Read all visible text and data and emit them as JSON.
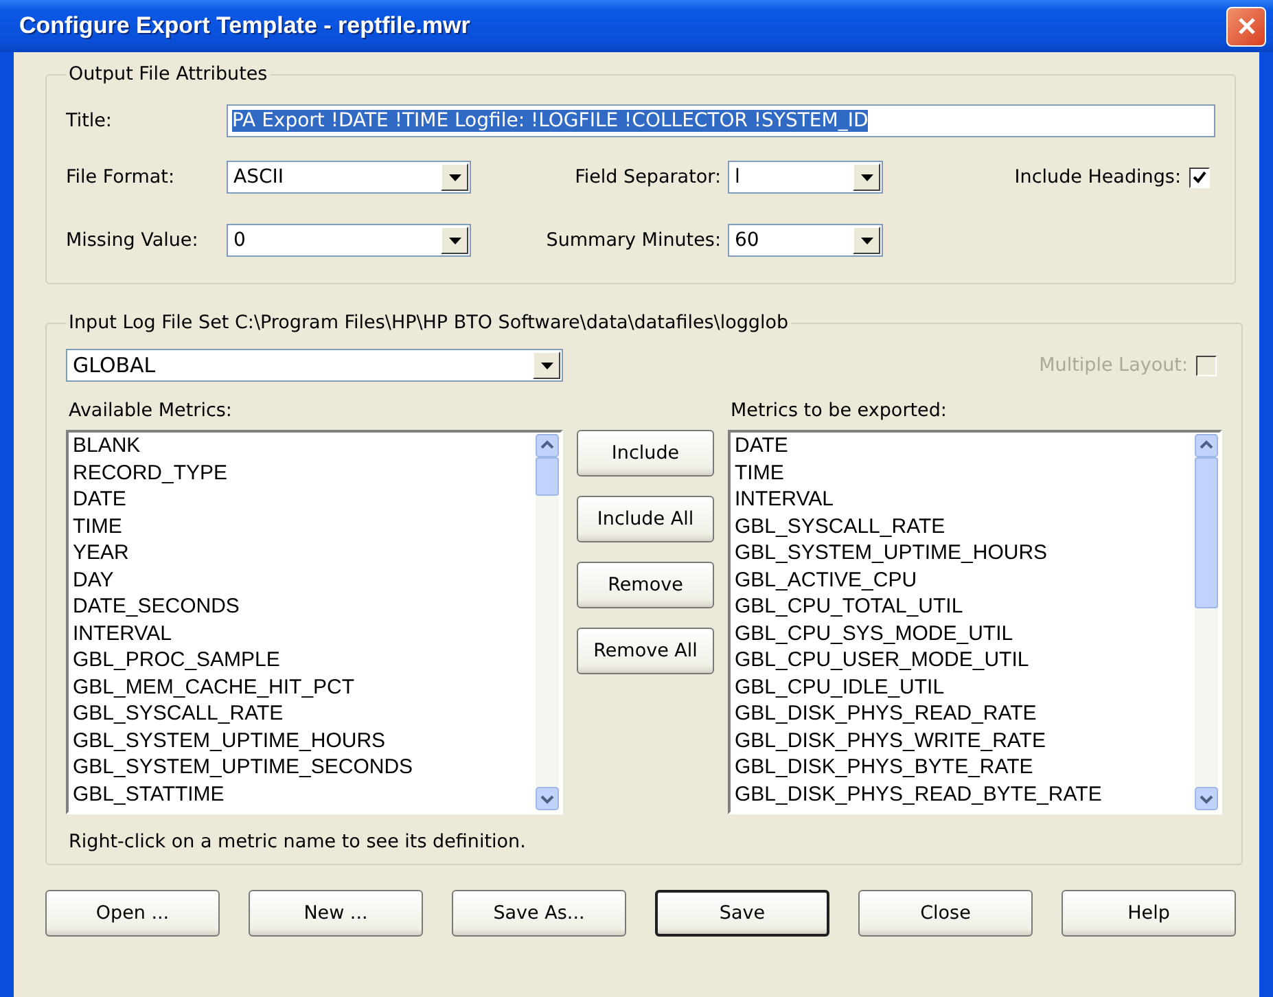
{
  "window": {
    "title": "Configure Export Template - reptfile.mwr"
  },
  "output_group": {
    "legend": "Output File Attributes",
    "title_field": {
      "label": "Title:",
      "value": "PA Export !DATE !TIME Logfile: !LOGFILE !COLLECTOR !SYSTEM_ID",
      "selected": true
    },
    "file_format": {
      "label": "File Format:",
      "value": "ASCII"
    },
    "field_separator": {
      "label": "Field Separator:",
      "value": "l"
    },
    "include_headings": {
      "label": "Include Headings:",
      "checked": true,
      "disabled": false
    },
    "missing_value": {
      "label": "Missing Value:",
      "value": "0"
    },
    "summary_minutes": {
      "label": "Summary Minutes:",
      "value": "60"
    }
  },
  "input_group": {
    "legend": "Input Log File Set C:\\Program Files\\HP\\HP BTO Software\\data\\datafiles\\logglob",
    "class_combo": {
      "value": "GLOBAL"
    },
    "multiple_layout": {
      "label": "Multiple Layout:",
      "checked": false,
      "disabled": true
    },
    "available": {
      "label": "Available Metrics:",
      "items": [
        "BLANK",
        "RECORD_TYPE",
        "DATE",
        "TIME",
        "YEAR",
        "DAY",
        "DATE_SECONDS",
        "INTERVAL",
        "GBL_PROC_SAMPLE",
        "GBL_MEM_CACHE_HIT_PCT",
        "GBL_SYSCALL_RATE",
        "GBL_SYSTEM_UPTIME_HOURS",
        "GBL_SYSTEM_UPTIME_SECONDS",
        "GBL_STATTIME"
      ]
    },
    "move_buttons": [
      "Include",
      "Include All",
      "Remove",
      "Remove All"
    ],
    "exported": {
      "label": "Metrics to be exported:",
      "items": [
        "DATE",
        "TIME",
        "INTERVAL",
        "GBL_SYSCALL_RATE",
        "GBL_SYSTEM_UPTIME_HOURS",
        "GBL_ACTIVE_CPU",
        "GBL_CPU_TOTAL_UTIL",
        "GBL_CPU_SYS_MODE_UTIL",
        "GBL_CPU_USER_MODE_UTIL",
        "GBL_CPU_IDLE_UTIL",
        "GBL_DISK_PHYS_READ_RATE",
        "GBL_DISK_PHYS_WRITE_RATE",
        "GBL_DISK_PHYS_BYTE_RATE",
        "GBL_DISK_PHYS_READ_BYTE_RATE"
      ]
    },
    "hint": "Right-click on a metric name to see its definition."
  },
  "buttons": [
    {
      "label": "Open ...",
      "default": false
    },
    {
      "label": "New ...",
      "default": false
    },
    {
      "label": "Save As...",
      "default": false
    },
    {
      "label": "Save",
      "default": true
    },
    {
      "label": "Close",
      "default": false
    },
    {
      "label": "Help",
      "default": false
    }
  ]
}
